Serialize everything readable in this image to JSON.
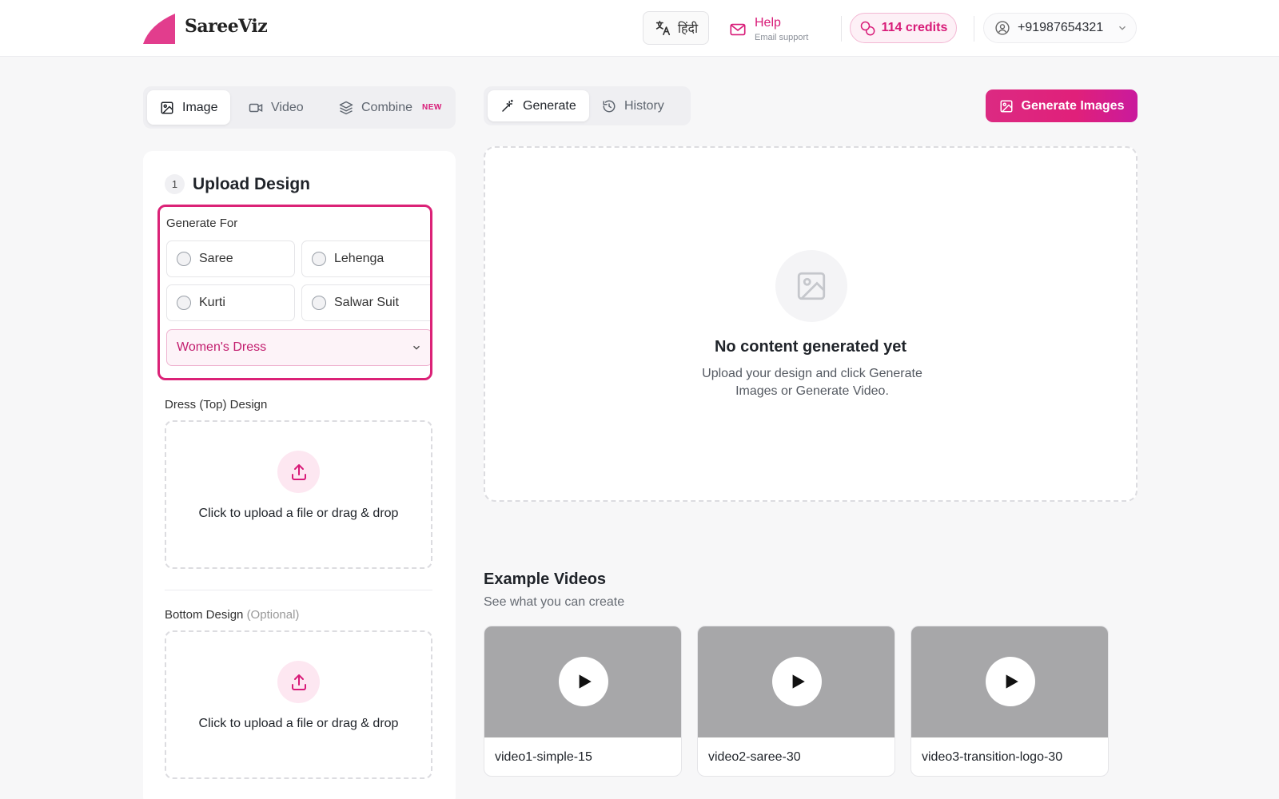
{
  "header": {
    "brand": "SareeViz",
    "language_label": "हिंदी",
    "help_title": "Help",
    "help_sub": "Email support",
    "credits_label": "114 credits",
    "phone": "+91987654321"
  },
  "mode_tabs": [
    {
      "label": "Image",
      "active": true
    },
    {
      "label": "Video",
      "active": false
    },
    {
      "label": "Combine",
      "badge": "NEW",
      "active": false
    }
  ],
  "gen_tabs": [
    {
      "label": "Generate",
      "active": true
    },
    {
      "label": "History",
      "active": false
    }
  ],
  "generate_images_label": "Generate Images",
  "upload_section": {
    "step": "1",
    "title": "Upload Design",
    "generate_for_label": "Generate For",
    "options": [
      "Saree",
      "Lehenga",
      "Kurti",
      "Salwar Suit"
    ],
    "selected_dress": "Women's Dress",
    "top_label": "Dress (Top) Design",
    "bottom_label": "Bottom Design",
    "bottom_optional": "(Optional)",
    "upload_text": "Click to upload a file or drag & drop"
  },
  "output": {
    "empty_title": "No content generated yet",
    "empty_sub": "Upload your design and click Generate Images or Generate Video."
  },
  "examples": {
    "title": "Example Videos",
    "subtitle": "See what you can create",
    "videos": [
      "video1-simple-15",
      "video2-saree-30",
      "video3-transition-logo-30"
    ]
  },
  "colors": {
    "accent": "#db2277",
    "accent_light": "#fde7f1",
    "thumb_gray": "#a7a7a9"
  }
}
